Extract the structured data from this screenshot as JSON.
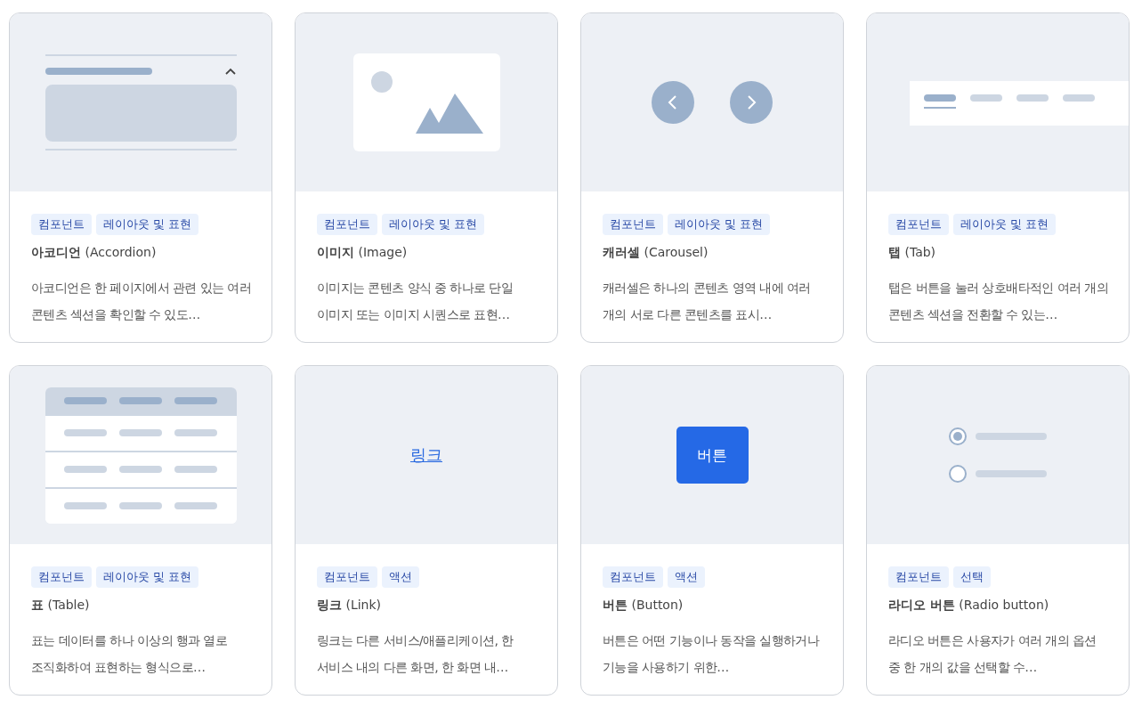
{
  "cards": [
    {
      "preview": {
        "kind": "accordion",
        "expanded": true
      },
      "tags": [
        "컴포넌트",
        "레이아웃 및 표현"
      ],
      "title": "**아코디언** (Accordion)",
      "description": "아코디언은 한 페이지에서 관련 있는 여러 콘텐츠 섹션을 확인할 수 있도…"
    },
    {
      "preview": {
        "kind": "image"
      },
      "tags": [
        "컴포넌트",
        "레이아웃 및 표현"
      ],
      "title": "**이미지** (Image)",
      "description": "이미지는 콘텐츠 양식 중 하나로 단일 이미지 또는 이미지 시퀀스로 표현…"
    },
    {
      "preview": {
        "kind": "carousel"
      },
      "tags": [
        "컴포넌트",
        "레이아웃 및 표현"
      ],
      "title": "**캐러셀** (Carousel)",
      "description": "캐러셀은 하나의 콘텐츠 영역 내에 여러 개의 서로 다른 콘텐츠를 표시…"
    },
    {
      "preview": {
        "kind": "tab",
        "tabs": [
          {
            "selected": true
          },
          {
            "selected": false
          },
          {
            "selected": false
          },
          {
            "selected": false
          }
        ]
      },
      "tags": [
        "컴포넌트",
        "레이아웃 및 표현"
      ],
      "title": "**탭** (Tab)",
      "description": "탭은 버튼을 눌러 상호배타적인 여러 개의 콘텐츠 섹션을 전환할 수 있는…"
    },
    {
      "preview": {
        "kind": "table"
      },
      "tags": [
        "컴포넌트",
        "레이아웃 및 표현"
      ],
      "title": "**표** (Table)",
      "description": "표는 데이터를 하나 이상의 행과 열로 조직화하여 표현하는 형식으로…"
    },
    {
      "preview": {
        "kind": "link",
        "label": "링크"
      },
      "tags": [
        "컴포넌트",
        "액션"
      ],
      "title": "**링크** (Link)",
      "description": "링크는 다른 서비스/애플리케이션, 한 서비스 내의 다른 화면, 한 화면 내…"
    },
    {
      "preview": {
        "kind": "button",
        "label": "버튼"
      },
      "tags": [
        "컴포넌트",
        "액션"
      ],
      "title": "**버튼** (Button)",
      "description": "버튼은 어떤 기능이나 동작을 실행하거나 기능을 사용하기 위한…"
    },
    {
      "preview": {
        "kind": "radio",
        "options": [
          {
            "selected": true
          },
          {
            "selected": false
          }
        ]
      },
      "tags": [
        "컴포넌트",
        "선택"
      ],
      "title": "**라디오 버튼** (Radio button)",
      "description": "라디오 버튼은 사용자가 여러 개의 옵션 중 한 개의 값을 선택할 수…"
    }
  ]
}
